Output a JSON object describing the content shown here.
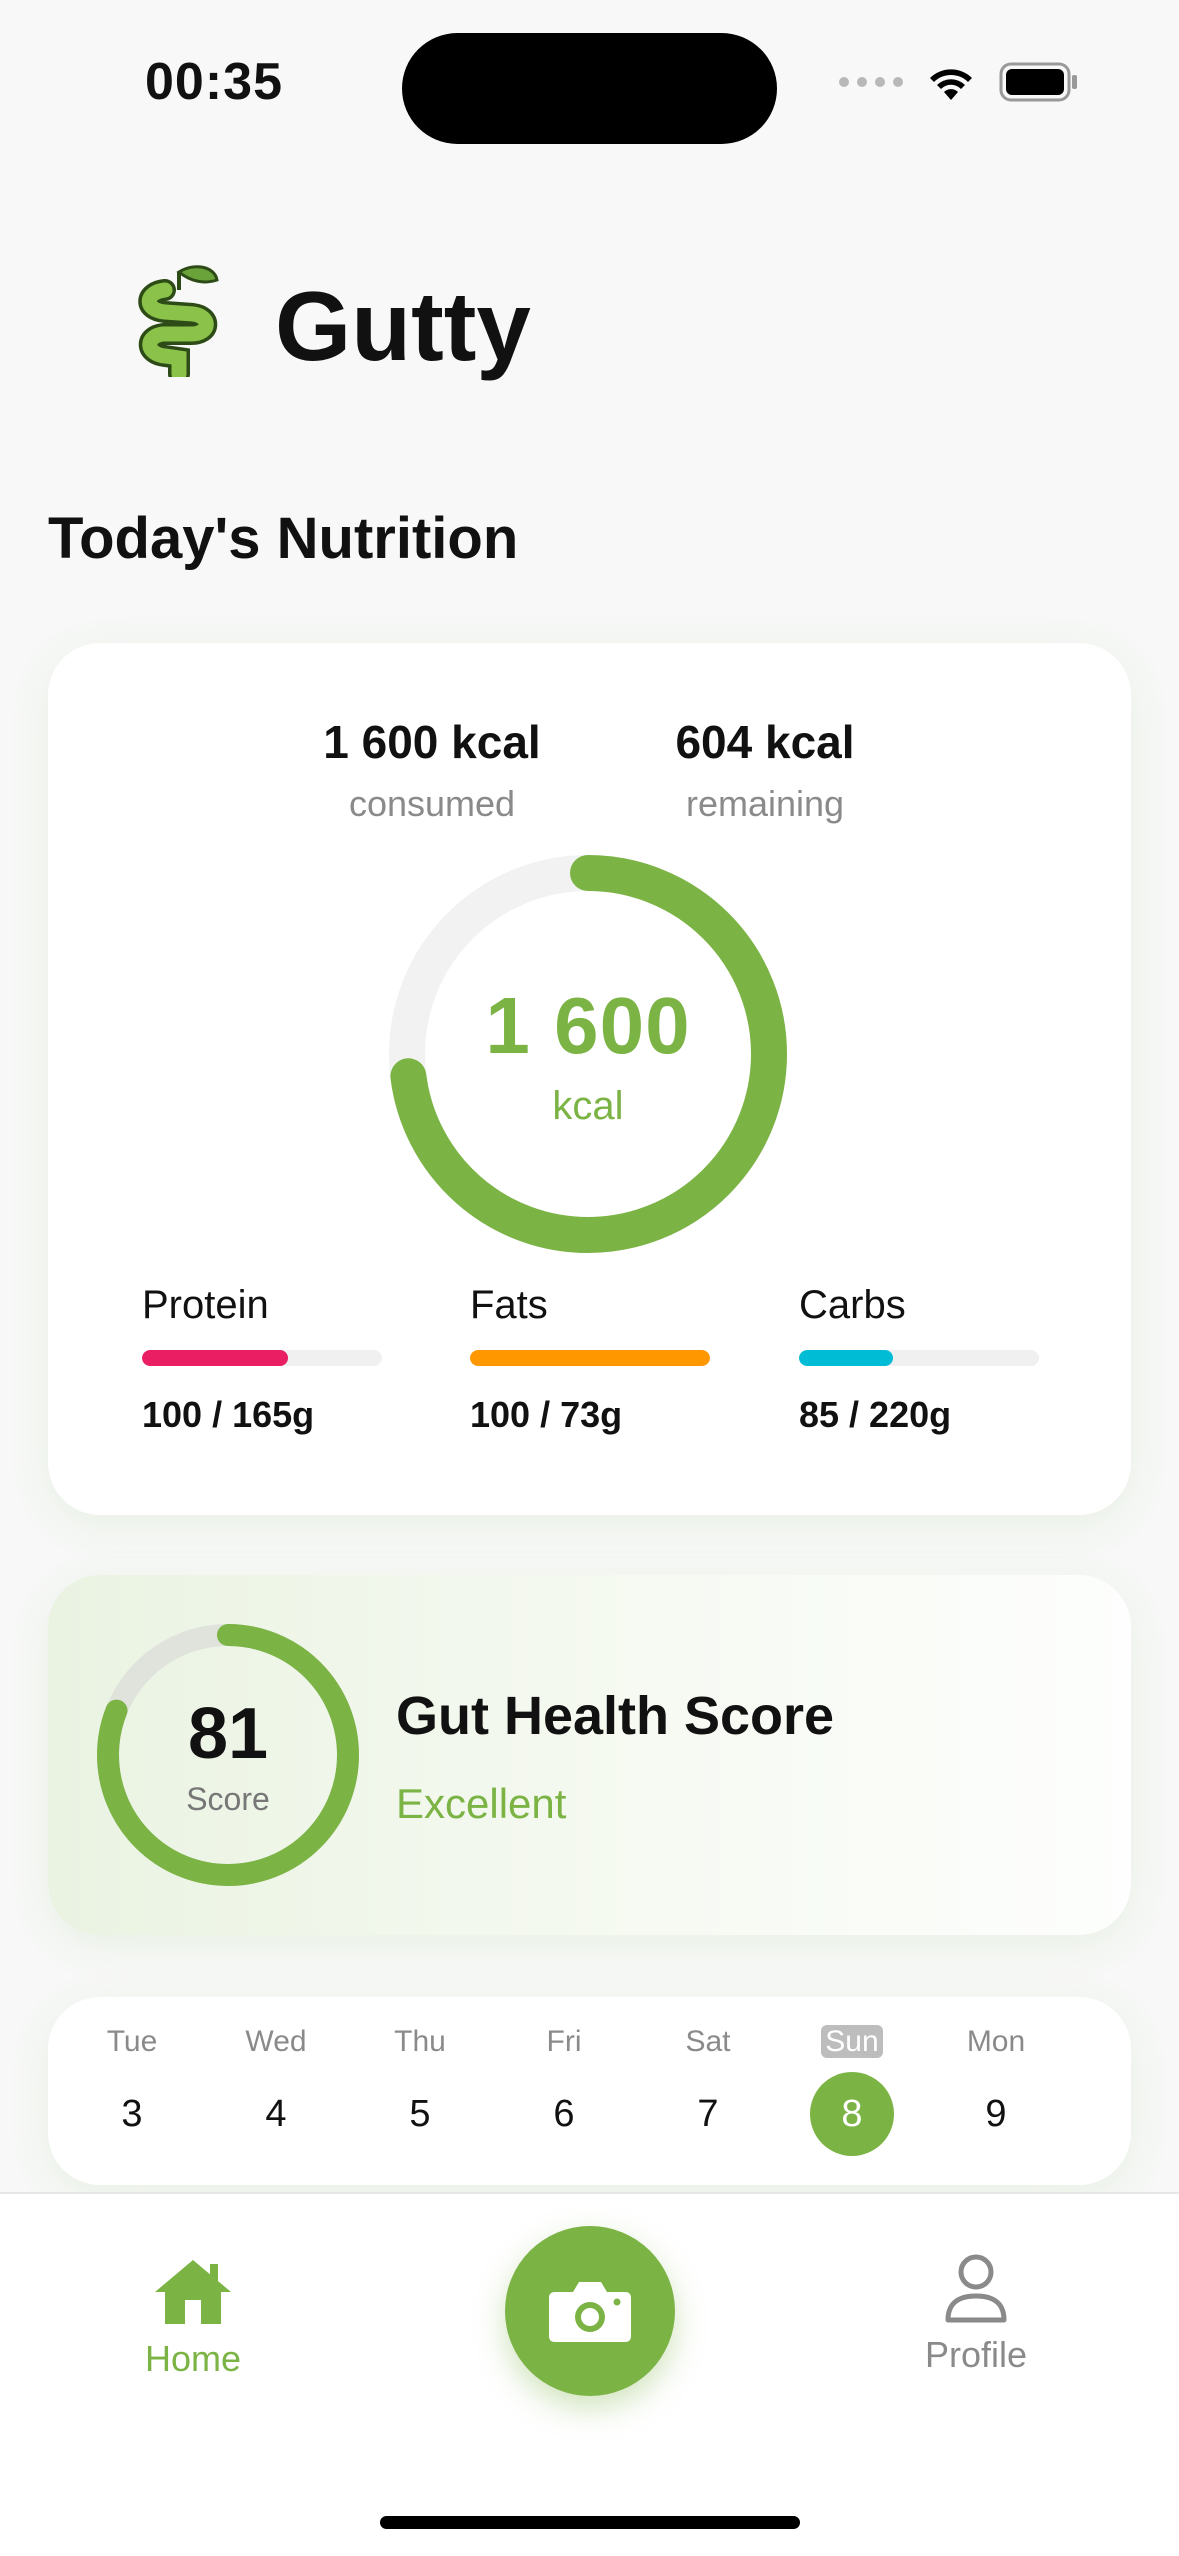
{
  "status_bar": {
    "time": "00:35"
  },
  "header": {
    "app_title": "Gutty"
  },
  "section_title": "Today's Nutrition",
  "nutrition": {
    "consumed_value": "1 600 kcal",
    "consumed_label": "consumed",
    "remaining_value": "604 kcal",
    "remaining_label": "remaining",
    "ring_value": "1 600",
    "ring_unit": "kcal",
    "ring_progress": 0.73,
    "ring_color": "#7bb344",
    "macros": [
      {
        "name": "Protein",
        "amount": "100 / 165g",
        "progress": 0.61,
        "color": "#e91e63"
      },
      {
        "name": "Fats",
        "amount": "100 / 73g",
        "progress": 1.0,
        "color": "#ff9800"
      },
      {
        "name": "Carbs",
        "amount": "85 / 220g",
        "progress": 0.39,
        "color": "#00bcd4"
      }
    ]
  },
  "gut_health": {
    "score": "81",
    "score_label": "Score",
    "progress": 0.81,
    "title": "Gut Health Score",
    "rating": "Excellent"
  },
  "calendar": {
    "days": [
      {
        "name": "Tue",
        "num": "3"
      },
      {
        "name": "Wed",
        "num": "4"
      },
      {
        "name": "Thu",
        "num": "5"
      },
      {
        "name": "Fri",
        "num": "6"
      },
      {
        "name": "Sat",
        "num": "7"
      },
      {
        "name": "Sun",
        "num": "8",
        "active": true
      },
      {
        "name": "Mon",
        "num": "9"
      }
    ]
  },
  "tabbar": {
    "home_label": "Home",
    "profile_label": "Profile",
    "home_icon": "house-icon",
    "camera_icon": "camera-icon",
    "profile_icon": "person-icon"
  },
  "colors": {
    "accent": "#7bb344",
    "text": "#111111",
    "muted": "#8a8a8a"
  }
}
